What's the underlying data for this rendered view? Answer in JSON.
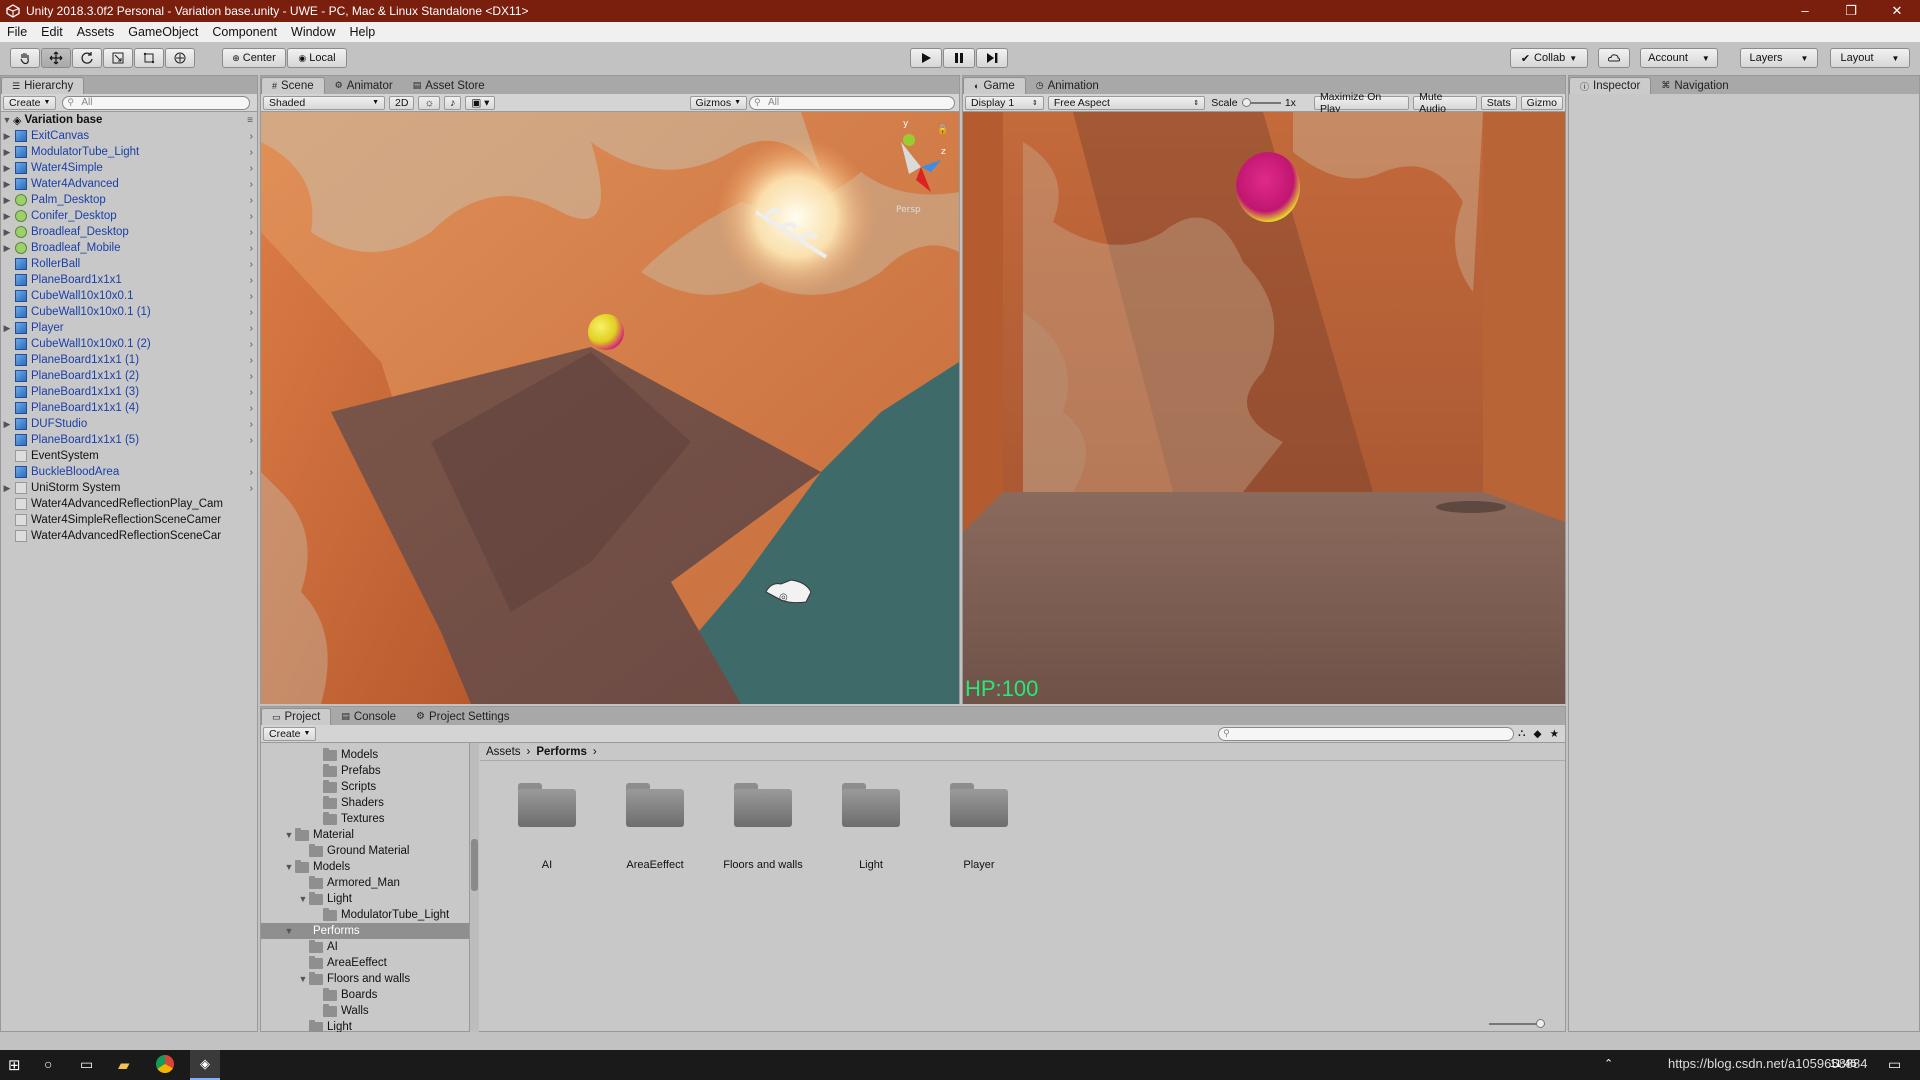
{
  "window": {
    "title": "Unity 2018.3.0f2 Personal - Variation base.unity - UWE - PC, Mac & Linux Standalone <DX11>"
  },
  "menu": [
    "File",
    "Edit",
    "Assets",
    "GameObject",
    "Component",
    "Window",
    "Help"
  ],
  "toolbar": {
    "pivot": "Center",
    "space": "Local",
    "collab": "Collab",
    "account": "Account",
    "layers": "Layers",
    "layout": "Layout"
  },
  "hierarchy": {
    "tab": "Hierarchy",
    "create": "Create",
    "search_placeholder": "All",
    "scene": "Variation base",
    "items": [
      {
        "label": "ExitCanvas",
        "icon": "cube-icon",
        "expand": true
      },
      {
        "label": "ModulatorTube_Light",
        "icon": "cube-icon",
        "expand": true
      },
      {
        "label": "Water4Simple",
        "icon": "cube-icon",
        "expand": true
      },
      {
        "label": "Water4Advanced",
        "icon": "cube-icon",
        "expand": true
      },
      {
        "label": "Palm_Desktop",
        "icon": "tree-icon",
        "expand": true
      },
      {
        "label": "Conifer_Desktop",
        "icon": "tree-icon",
        "expand": true
      },
      {
        "label": "Broadleaf_Desktop",
        "icon": "tree-icon",
        "expand": true
      },
      {
        "label": "Broadleaf_Mobile",
        "icon": "tree-icon",
        "expand": true
      },
      {
        "label": "RollerBall",
        "icon": "cube-icon",
        "expand": false
      },
      {
        "label": "PlaneBoard1x1x1",
        "icon": "cube-icon",
        "expand": false
      },
      {
        "label": "CubeWall10x10x0.1",
        "icon": "cube-icon",
        "expand": false
      },
      {
        "label": "CubeWall10x10x0.1 (1)",
        "icon": "cube-icon",
        "expand": false
      },
      {
        "label": "Player",
        "icon": "cube-icon",
        "expand": true
      },
      {
        "label": "CubeWall10x10x0.1 (2)",
        "icon": "cube-icon",
        "expand": false
      },
      {
        "label": "PlaneBoard1x1x1 (1)",
        "icon": "cube-icon",
        "expand": false
      },
      {
        "label": "PlaneBoard1x1x1 (2)",
        "icon": "cube-icon",
        "expand": false
      },
      {
        "label": "PlaneBoard1x1x1 (3)",
        "icon": "cube-icon",
        "expand": false
      },
      {
        "label": "PlaneBoard1x1x1 (4)",
        "icon": "cube-icon",
        "expand": false
      },
      {
        "label": "DUFStudio",
        "icon": "cube-icon",
        "expand": true
      },
      {
        "label": "PlaneBoard1x1x1 (5)",
        "icon": "cube-icon",
        "expand": false
      },
      {
        "label": "EventSystem",
        "icon": "gameobject-icon",
        "expand": false
      },
      {
        "label": "BuckleBloodArea",
        "icon": "cube-icon",
        "expand": false
      },
      {
        "label": "UniStorm System",
        "icon": "gameobject-icon",
        "expand": true
      },
      {
        "label": "Water4AdvancedReflectionPlay_Cam",
        "icon": "gameobject-icon",
        "expand": false
      },
      {
        "label": "Water4SimpleReflectionSceneCamer",
        "icon": "gameobject-icon",
        "expand": false
      },
      {
        "label": "Water4AdvancedReflectionSceneCar",
        "icon": "gameobject-icon",
        "expand": false
      }
    ]
  },
  "scene_view": {
    "tabs": [
      "Scene",
      "Animator",
      "Asset Store"
    ],
    "shading": "Shaded",
    "mode2d": "2D",
    "gizmos": "Gizmos",
    "search_placeholder": "All",
    "persp": "Persp",
    "axis_y": "y",
    "axis_z": "z"
  },
  "game_view": {
    "tabs": [
      "Game",
      "Animation"
    ],
    "display": "Display 1",
    "aspect": "Free Aspect",
    "scale_label": "Scale",
    "scale_value": "1x",
    "options": [
      "Maximize On Play",
      "Mute Audio",
      "Stats",
      "Gizmo"
    ],
    "hp": "HP:100"
  },
  "inspector": {
    "tabs": [
      "Inspector",
      "Navigation"
    ]
  },
  "project": {
    "tabs": [
      "Project",
      "Console",
      "Project Settings"
    ],
    "create": "Create",
    "breadcrumb": [
      "Assets",
      "Performs"
    ],
    "tree": [
      {
        "label": "Models",
        "indent": 3,
        "arrow": ""
      },
      {
        "label": "Prefabs",
        "indent": 3,
        "arrow": ""
      },
      {
        "label": "Scripts",
        "indent": 3,
        "arrow": ""
      },
      {
        "label": "Shaders",
        "indent": 3,
        "arrow": ""
      },
      {
        "label": "Textures",
        "indent": 3,
        "arrow": ""
      },
      {
        "label": "Material",
        "indent": 1,
        "arrow": "▼"
      },
      {
        "label": "Ground Material",
        "indent": 2,
        "arrow": ""
      },
      {
        "label": "Models",
        "indent": 1,
        "arrow": "▼"
      },
      {
        "label": "Armored_Man",
        "indent": 2,
        "arrow": ""
      },
      {
        "label": "Light",
        "indent": 2,
        "arrow": "▼"
      },
      {
        "label": "ModulatorTube_Light",
        "indent": 3,
        "arrow": ""
      },
      {
        "label": "Performs",
        "indent": 1,
        "arrow": "▼",
        "selected": true
      },
      {
        "label": "AI",
        "indent": 2,
        "arrow": ""
      },
      {
        "label": "AreaEeffect",
        "indent": 2,
        "arrow": ""
      },
      {
        "label": "Floors and walls",
        "indent": 2,
        "arrow": "▼"
      },
      {
        "label": "Boards",
        "indent": 3,
        "arrow": ""
      },
      {
        "label": "Walls",
        "indent": 3,
        "arrow": ""
      },
      {
        "label": "Light",
        "indent": 2,
        "arrow": ""
      }
    ],
    "folders": [
      "AI",
      "AreaEeffect",
      "Floors and walls",
      "Light",
      "Player"
    ]
  },
  "taskbar": {
    "watermark": "https://blog.csdn.net/a1059658884",
    "time": "11:45"
  }
}
